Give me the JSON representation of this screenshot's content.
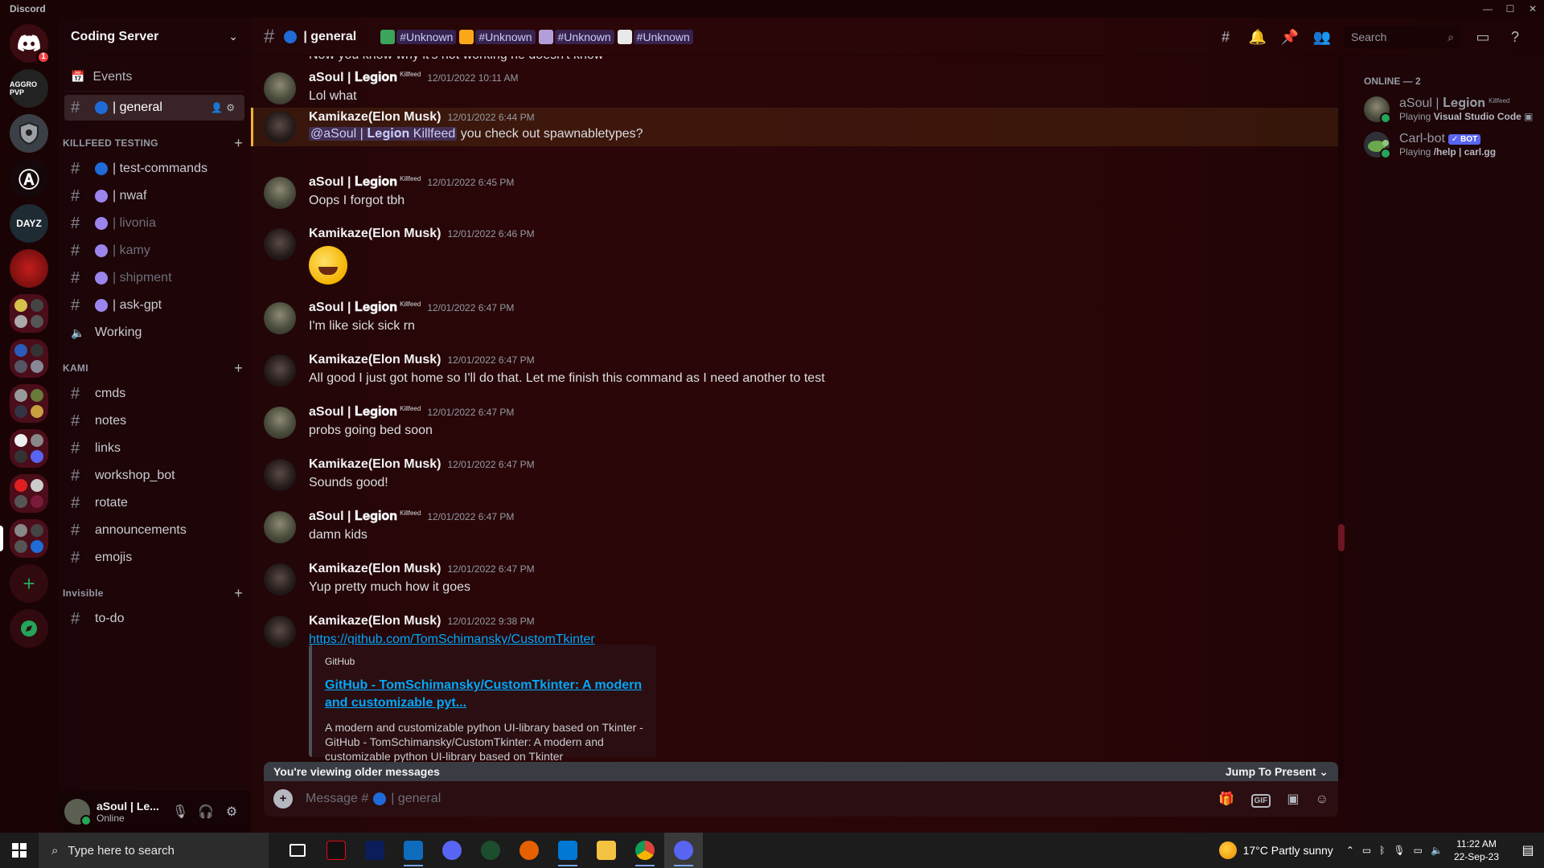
{
  "titlebar": {
    "app_name": "Discord",
    "minimize": "—",
    "maximize": "☐",
    "close": "✕"
  },
  "guilds": {
    "home_badge": "1",
    "items": [
      {
        "label": "AGGRO PVP",
        "color": "#222222"
      },
      {
        "label": "",
        "color": "#3b3f46"
      },
      {
        "label": "Ⓐ",
        "color": "#15080a"
      },
      {
        "label": "DAYZ",
        "color": "#1e2b33"
      },
      {
        "label": "",
        "color": "#7a1010"
      }
    ]
  },
  "sidebar": {
    "server_name": "Coding Server",
    "events_label": "Events",
    "active_channel": "| general",
    "categories": [
      {
        "name": "KILLFEED TESTING",
        "channels": [
          {
            "name": "| test-commands",
            "dot": "#1f6bd8",
            "style": "bright"
          },
          {
            "name": "| nwaf",
            "dot": "#9b84ec",
            "style": "bright"
          },
          {
            "name": "| livonia",
            "dot": "#9b84ec",
            "style": "muted"
          },
          {
            "name": "| kamy",
            "dot": "#9b84ec",
            "style": "muted"
          },
          {
            "name": "| shipment",
            "dot": "#9b84ec",
            "style": "muted"
          },
          {
            "name": "| ask-gpt",
            "dot": "#9b84ec",
            "style": "bright"
          }
        ],
        "voice": "Working"
      },
      {
        "name": "KAMI",
        "channels": [
          {
            "name": "cmds"
          },
          {
            "name": "notes"
          },
          {
            "name": "links"
          },
          {
            "name": "workshop_bot"
          },
          {
            "name": "rotate"
          },
          {
            "name": "announcements"
          },
          {
            "name": "emojis"
          }
        ]
      },
      {
        "name": "Invisible",
        "channels": [
          {
            "name": "to-do"
          }
        ]
      }
    ]
  },
  "user_panel": {
    "name": "aSoul | Le...",
    "status": "Online"
  },
  "chat_header": {
    "channel_title": "| general",
    "mentions": [
      {
        "color": "#3ba55c",
        "text": "#Unknown"
      },
      {
        "color": "#faa81a",
        "text": "#Unknown"
      },
      {
        "color": "#b39ddb",
        "text": "#Unknown"
      },
      {
        "color": "#e8e8e8",
        "text": "#Unknown"
      }
    ],
    "search_placeholder": "Search"
  },
  "messages": {
    "truncated_top": "Now you know why it's not working he doesn't know",
    "items": [
      {
        "author": "aSoul | 𝐋𝐞𝐠𝐢𝐨𝐧",
        "tag": "Killfeed",
        "avatar": "asoul",
        "time": "12/01/2022 10:11 AM",
        "text": "Lol what"
      },
      {
        "author": "Kamikaze(Elon Musk)",
        "tag": "",
        "avatar": "kami",
        "time": "12/01/2022 6:44 PM",
        "mention": "@aSoul | 𝐋𝐞𝐠𝐢𝐨𝐧 Killfeed",
        "text": " you check out spawnabletypes?",
        "highlight": true
      },
      {
        "author": "aSoul | 𝐋𝐞𝐠𝐢𝐨𝐧",
        "tag": "Killfeed",
        "avatar": "asoul",
        "time": "12/01/2022 6:45 PM",
        "text": "Oops I forgot tbh"
      },
      {
        "author": "Kamikaze(Elon Musk)",
        "tag": "",
        "avatar": "kami",
        "time": "12/01/2022 6:46 PM",
        "text": "",
        "emoji": "rolling-on-floor-laughing"
      },
      {
        "author": "aSoul | 𝐋𝐞𝐠𝐢𝐨𝐧",
        "tag": "Killfeed",
        "avatar": "asoul",
        "time": "12/01/2022 6:47 PM",
        "text": "I'm like sick sick rn"
      },
      {
        "author": "Kamikaze(Elon Musk)",
        "tag": "",
        "avatar": "kami",
        "time": "12/01/2022 6:47 PM",
        "text": "All good I just got home so I'll do that. Let me finish this command as I need another to test"
      },
      {
        "author": "aSoul | 𝐋𝐞𝐠𝐢𝐨𝐧",
        "tag": "Killfeed",
        "avatar": "asoul",
        "time": "12/01/2022 6:47 PM",
        "text": "probs going bed soon"
      },
      {
        "author": "Kamikaze(Elon Musk)",
        "tag": "",
        "avatar": "kami",
        "time": "12/01/2022 6:47 PM",
        "text": "Sounds good!"
      },
      {
        "author": "aSoul | 𝐋𝐞𝐠𝐢𝐨𝐧",
        "tag": "Killfeed",
        "avatar": "asoul",
        "time": "12/01/2022 6:47 PM",
        "text": "damn kids"
      },
      {
        "author": "Kamikaze(Elon Musk)",
        "tag": "",
        "avatar": "kami",
        "time": "12/01/2022 6:47 PM",
        "text": "Yup pretty much how it goes"
      },
      {
        "author": "Kamikaze(Elon Musk)",
        "tag": "",
        "avatar": "kami",
        "time": "12/01/2022 9:38 PM",
        "link": "https://github.com/TomSchimansky/CustomTkinter",
        "embed": {
          "provider": "GitHub",
          "title": "GitHub - TomSchimansky/CustomTkinter: A modern and customizable pyt...",
          "description": "A modern and customizable python UI-library based on Tkinter - GitHub - TomSchimansky/CustomTkinter: A modern and customizable python UI-library based on Tkinter"
        }
      }
    ]
  },
  "older_bar": {
    "left": "You're viewing older messages",
    "right": "Jump To Present"
  },
  "composer": {
    "placeholder_prefix": "Message #",
    "placeholder_channel": "| general",
    "gif_label": "GIF"
  },
  "members": {
    "heading": "ONLINE — 2",
    "items": [
      {
        "name": "aSoul | 𝐋𝐞𝐠𝐢𝐨𝐧",
        "tag": "Killfeed",
        "activity_prefix": "Playing ",
        "activity": "Visual Studio Code",
        "avatar": "asoul"
      },
      {
        "name": "Carl-bot",
        "bot": "✓ BOT",
        "activity_prefix": "Playing ",
        "activity": "/help | carl.gg",
        "avatar": "carl"
      }
    ]
  },
  "taskbar": {
    "search_placeholder": "Type here to search",
    "weather": "17°C  Partly sunny",
    "time": "11:22 AM",
    "date": "22-Sep-23"
  }
}
